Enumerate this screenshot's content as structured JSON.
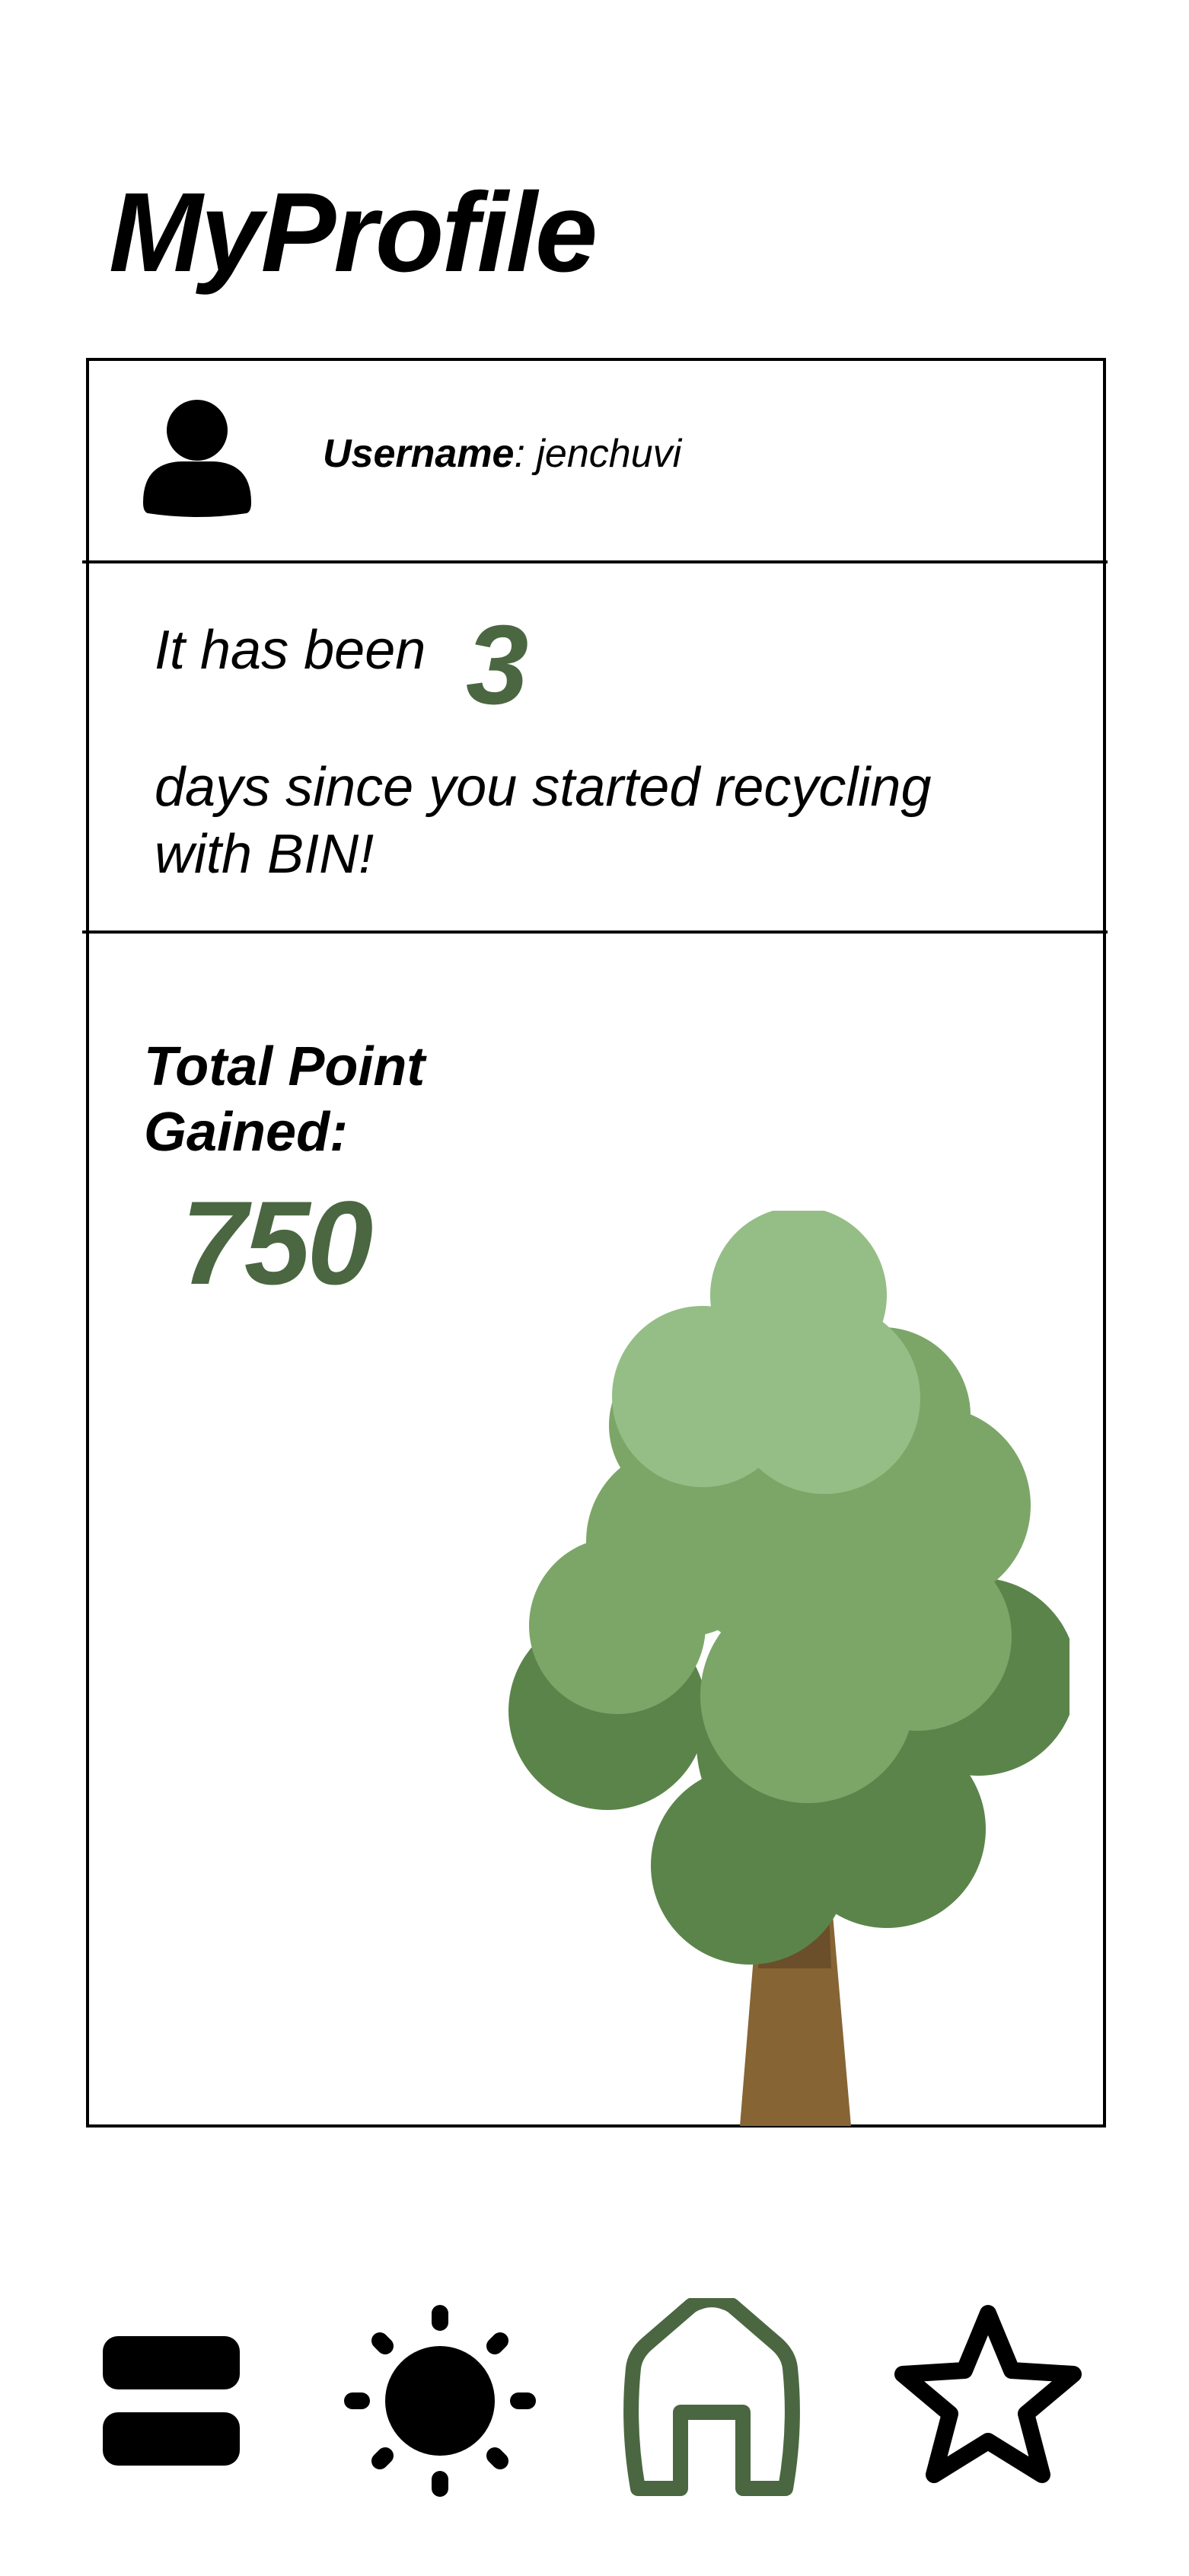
{
  "header": {
    "title": "MyProfile"
  },
  "profile": {
    "username_label": "Username",
    "username_separator": ": ",
    "username_value": "jenchuvi"
  },
  "recycling": {
    "intro": "It has been",
    "days": "3",
    "rest": "days since you started recycling with BIN!"
  },
  "points": {
    "label": "Total Point Gained:",
    "value": "750"
  },
  "illustration": {
    "name": "tree-illustration"
  },
  "bottom_nav": {
    "items": [
      {
        "icon": "menu-icon",
        "active": false
      },
      {
        "icon": "sun-icon",
        "active": false
      },
      {
        "icon": "home-icon",
        "active": true
      },
      {
        "icon": "star-icon",
        "active": false
      }
    ]
  },
  "colors": {
    "accent": "#4a6741",
    "text": "#000000",
    "background": "#ffffff",
    "tree_light": "#94be85",
    "tree_mid": "#7ca668",
    "tree_dark": "#5b844a",
    "trunk_light": "#866434",
    "trunk_dark": "#6b4f2a"
  }
}
